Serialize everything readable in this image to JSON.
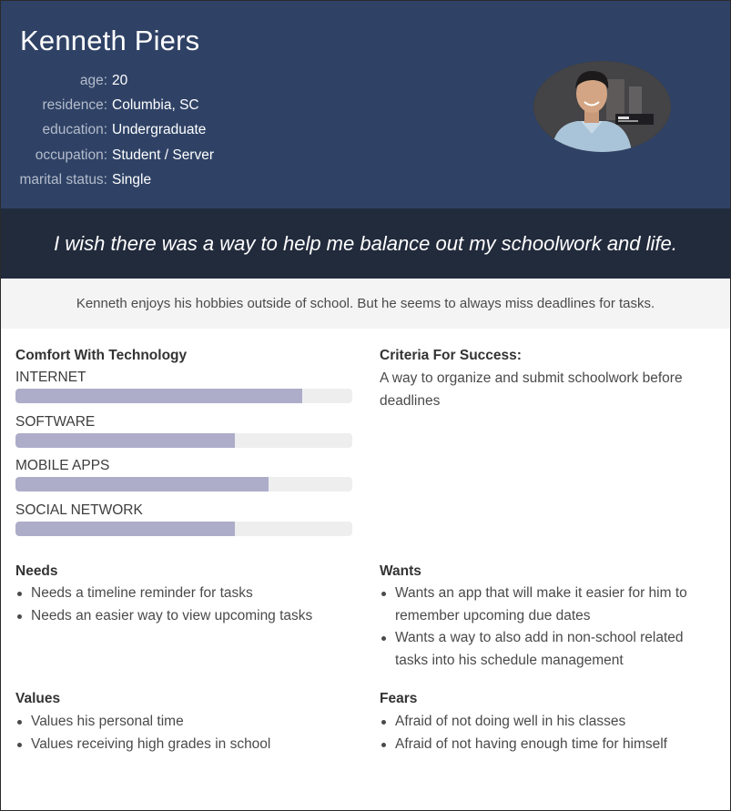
{
  "persona": {
    "name": "Kenneth Piers",
    "details": [
      {
        "label": "age:",
        "value": "20"
      },
      {
        "label": "residence:",
        "value": "Columbia, SC"
      },
      {
        "label": "education:",
        "value": "Undergraduate"
      },
      {
        "label": "occupation:",
        "value": "Student / Server"
      },
      {
        "label": "marital status:",
        "value": "Single"
      }
    ],
    "photo_icon": "person-photo"
  },
  "quote": "I wish there was a way to help me balance out my schoolwork and life.",
  "summary": "Kenneth enjoys his hobbies outside of school. But he seems to always miss deadlines for tasks.",
  "tech": {
    "title": "Comfort With Technology",
    "items": [
      {
        "label": "INTERNET",
        "level": 0.85
      },
      {
        "label": "SOFTWARE",
        "level": 0.65
      },
      {
        "label": "MOBILE APPS",
        "level": 0.75
      },
      {
        "label": "SOCIAL NETWORK",
        "level": 0.65
      }
    ]
  },
  "criteria": {
    "title": "Criteria For Success:",
    "text": "A way to organize and submit schoolwork before deadlines"
  },
  "needs": {
    "title": "Needs",
    "items": [
      "Needs a timeline reminder for tasks",
      "Needs an easier way to view upcoming tasks"
    ]
  },
  "wants": {
    "title": "Wants",
    "items": [
      "Wants an app that will make it easier for him to remember upcoming due dates",
      "Wants a way to also add in non-school related tasks into his schedule management"
    ]
  },
  "values": {
    "title": "Values",
    "items": [
      "Values his personal time",
      "Values receiving high grades in school"
    ]
  },
  "fears": {
    "title": "Fears",
    "items": [
      "Afraid of not doing well in his classes",
      "Afraid of not having enough time for himself"
    ]
  },
  "colors": {
    "header": "#2f4266",
    "quote_band": "#222b3c",
    "bar_fill": "#adadc9",
    "bar_track": "#eeeeef"
  }
}
